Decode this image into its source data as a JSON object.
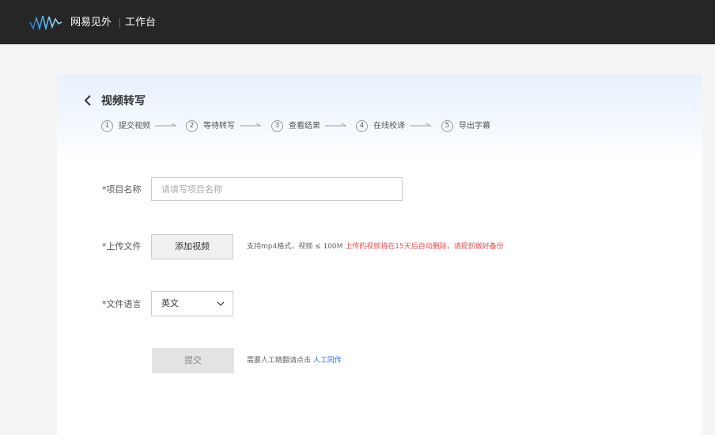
{
  "header": {
    "brand": "网易见外",
    "workspace": "工作台"
  },
  "page": {
    "title": "视频转写"
  },
  "steps": [
    {
      "num": "1",
      "label": "提交视频"
    },
    {
      "num": "2",
      "label": "等待转写"
    },
    {
      "num": "3",
      "label": "查看结果"
    },
    {
      "num": "4",
      "label": "在线校译"
    },
    {
      "num": "5",
      "label": "导出字幕"
    }
  ],
  "form": {
    "name_label": "*项目名称",
    "name_placeholder": "请填写项目名称",
    "name_value": "",
    "upload_label": "*上传文件",
    "upload_button": "添加视频",
    "upload_hint": "支持mp4格式，视频 ≤ 100M",
    "upload_warning": "上传的视频将在15天后自动删除，请提前做好备份",
    "language_label": "*文件语言",
    "language_value": "英文",
    "submit_button": "提交",
    "manual_hint": "需要人工精翻请点击",
    "manual_link": "人工同传"
  },
  "colors": {
    "topbar": "#262626",
    "link": "#2a74d8",
    "warning": "#e05050",
    "logo": "#3aa0e8"
  },
  "icons": {
    "logo": "wave-logo-icon",
    "back": "chevron-left-icon",
    "select": "chevron-down-icon",
    "step_arrow": "arrow-right-icon"
  }
}
